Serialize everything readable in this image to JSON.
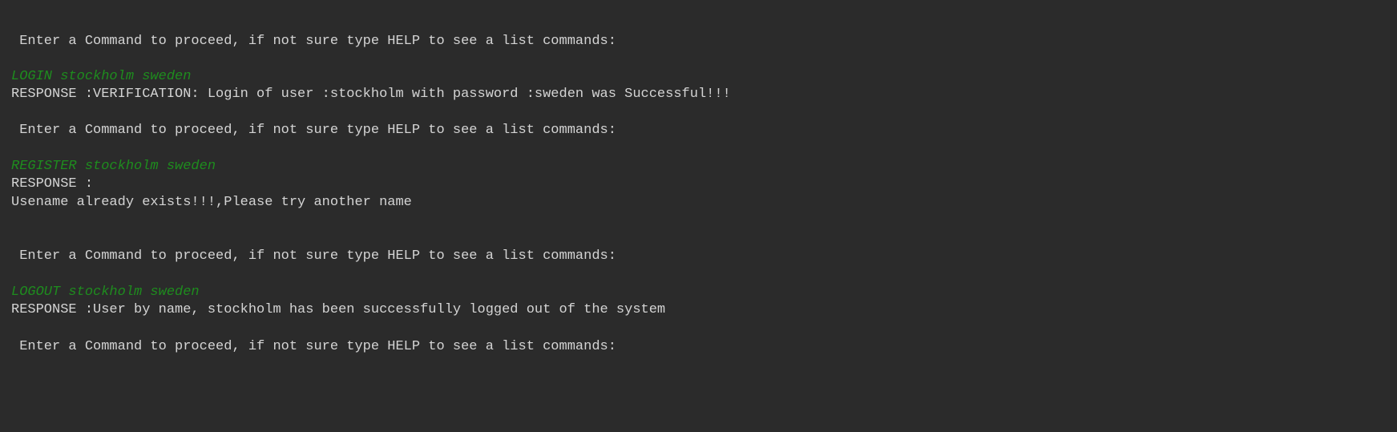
{
  "console": {
    "lines": [
      {
        "type": "prompt",
        "text": " Enter a Command to proceed, if not sure type HELP to see a list commands:"
      },
      {
        "type": "input",
        "text": "LOGIN stockholm sweden"
      },
      {
        "type": "output",
        "text": "RESPONSE :VERIFICATION: Login of user :stockholm with password :sweden was Successful!!!"
      },
      {
        "type": "prompt",
        "text": " Enter a Command to proceed, if not sure type HELP to see a list commands:"
      },
      {
        "type": "input",
        "text": "REGISTER stockholm sweden"
      },
      {
        "type": "output",
        "text": "RESPONSE :"
      },
      {
        "type": "output",
        "text": "Usename already exists!!!,Please try another name"
      },
      {
        "type": "prompt",
        "text": " Enter a Command to proceed, if not sure type HELP to see a list commands:"
      },
      {
        "type": "input",
        "text": "LOGOUT stockholm sweden"
      },
      {
        "type": "output",
        "text": "RESPONSE :User by name, stockholm has been successfully logged out of the system"
      },
      {
        "type": "prompt",
        "text": " Enter a Command to proceed, if not sure type HELP to see a list commands:"
      }
    ]
  },
  "colors": {
    "background": "#2b2b2b",
    "text": "#d4d4d4",
    "command": "#1e8c1e"
  }
}
